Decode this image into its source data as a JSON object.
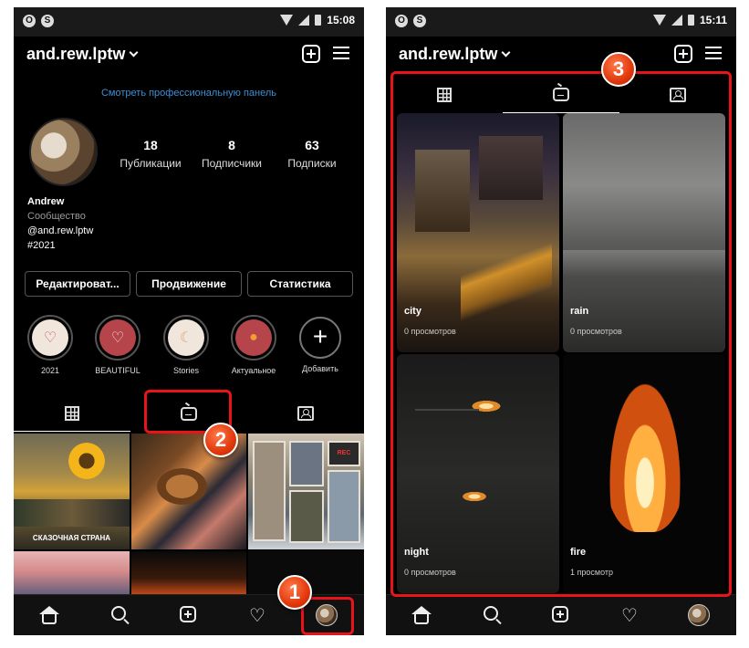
{
  "left": {
    "status": {
      "time": "15:08"
    },
    "username": "and.rew.lptw",
    "pro_dashboard_link": "Смотреть профессиональную панель",
    "stats": [
      {
        "value": "18",
        "label": "Публикации"
      },
      {
        "value": "8",
        "label": "Подписчики"
      },
      {
        "value": "63",
        "label": "Подписки"
      }
    ],
    "bio": {
      "name": "Andrew",
      "category": "Сообщество",
      "handle": "@and.rew.lptw",
      "tag": "#2021"
    },
    "buttons": {
      "edit": "Редактироват...",
      "promote": "Продвижение",
      "stats": "Статистика"
    },
    "highlights": [
      {
        "label": "2021",
        "icon": "heart-outline-icon"
      },
      {
        "label": "BEAUTIFUL",
        "icon": "heart-outline-icon"
      },
      {
        "label": "Stories",
        "icon": "moon-icon"
      },
      {
        "label": "Актуальное",
        "icon": "apple-icon"
      },
      {
        "label": "Добавить",
        "icon": "plus-icon"
      }
    ],
    "post_caption": "СКАЗОЧНАЯ СТРАНА",
    "sticker_rec": "REC",
    "markers": [
      "2",
      "1"
    ]
  },
  "right": {
    "status": {
      "time": "15:11"
    },
    "username": "and.rew.lptw",
    "marker": "3",
    "videos": [
      {
        "title": "city",
        "views": "0 просмотров"
      },
      {
        "title": "rain",
        "views": "0 просмотров"
      },
      {
        "title": "night",
        "views": "0 просмотров"
      },
      {
        "title": "fire",
        "views": "1 просмотр"
      }
    ]
  },
  "colors": {
    "accent_link": "#3b8fd6",
    "annotation_red": "#e8141a",
    "background": "#000000"
  }
}
